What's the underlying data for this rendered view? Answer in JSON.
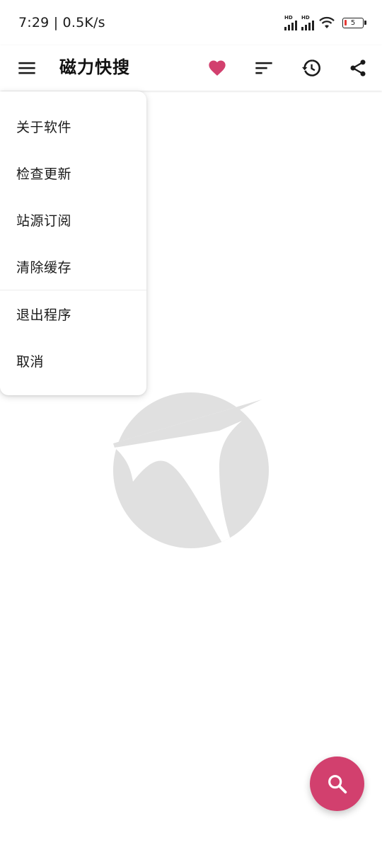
{
  "status_bar": {
    "time_speed": "7:29 | 0.5K/s",
    "signal_1_label": "HD",
    "signal_2_label": "HD",
    "battery_level": "5"
  },
  "app_bar": {
    "title": "磁力快搜"
  },
  "menu": {
    "items": [
      {
        "label": "关于软件"
      },
      {
        "label": "检查更新"
      },
      {
        "label": "站源订阅"
      },
      {
        "label": "清除缓存"
      },
      {
        "label": "退出程序"
      },
      {
        "label": "取消"
      }
    ]
  },
  "colors": {
    "accent": "#d2406e",
    "favorite": "#d2406e",
    "watermark": "#e0e0e0",
    "battery_low": "#e53935"
  },
  "icons": {
    "menu": "hamburger-menu-icon",
    "favorite": "heart-icon",
    "sort": "sort-icon",
    "history": "history-icon",
    "share": "share-icon",
    "search": "search-icon"
  }
}
